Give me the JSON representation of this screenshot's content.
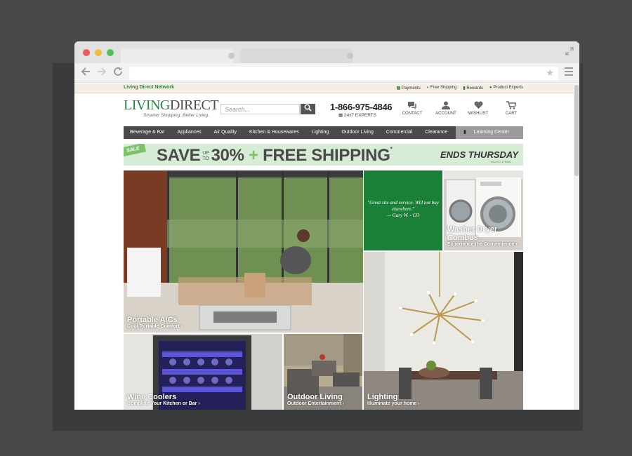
{
  "browser": {
    "star_glyph": "★"
  },
  "site": {
    "network_label": "Living Direct Network",
    "top_links": [
      "Payments",
      "Free Shipping",
      "Rewards",
      "Product Experts"
    ],
    "logo_main_green": "LIVING",
    "logo_main_gray": "DIRECT",
    "tagline": "Smarter Shopping. Better Living.",
    "search_placeholder": "Search...",
    "phone": "1-866-975-4846",
    "experts": "24x7 EXPERTS",
    "header_icons": [
      {
        "label": "CONTACT",
        "icon": "chat-icon"
      },
      {
        "label": "ACCOUNT",
        "icon": "user-icon"
      },
      {
        "label": "WISHLIST",
        "icon": "heart-icon"
      },
      {
        "label": "CART",
        "icon": "cart-icon"
      }
    ],
    "nav": [
      "Beverage & Bar",
      "Appliances",
      "Air Quality",
      "Kitchen & Housewares",
      "Lighting",
      "Outdoor Living",
      "Commercial",
      "Clearance"
    ],
    "nav_learning": "Learning Center",
    "brand_color": "#1a8037"
  },
  "banner": {
    "sale_tag": "SALE",
    "save": "SAVE",
    "up_to_1": "UP",
    "up_to_2": "TO",
    "percent": "30%",
    "plus": "+",
    "free_shipping": "FREE SHIPPING",
    "asterisk": "*",
    "ends": "ENDS THURSDAY",
    "ends_note": "* SELECT ITEMS"
  },
  "tiles": {
    "portable_ac": {
      "title": "Portable A/Cs",
      "subtitle": "Cool Portable Comfort ›"
    },
    "quote": {
      "text": "\"Great site and service. Will not buy elsewhere.\"",
      "author": "— Gary W. - CO"
    },
    "washer": {
      "title": "Washer Dryer Combos",
      "subtitle": "Experience the Convenience ›"
    },
    "wine": {
      "title": "Wine Coolers",
      "subtitle": "Complete Your Kitchen or Bar ›"
    },
    "outdoor": {
      "title": "Outdoor Living",
      "subtitle": "Outdoor Entertainment ›"
    },
    "lighting": {
      "title": "Lighting",
      "subtitle": "Illuminate your home ›"
    }
  }
}
